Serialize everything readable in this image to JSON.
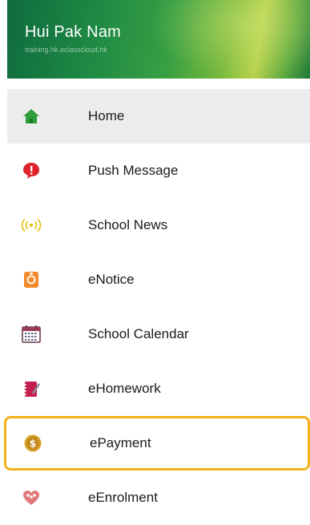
{
  "header": {
    "user_name": "Hui Pak Nam",
    "user_sub": "training.hk.eclasscloud.hk"
  },
  "menu": {
    "items": [
      {
        "label": "Home",
        "icon": "home-icon",
        "color": "#2e9e3c"
      },
      {
        "label": "Push Message",
        "icon": "chat-bubble-icon",
        "color": "#e0222b"
      },
      {
        "label": "School News",
        "icon": "broadcast-icon",
        "color": "#e8c21c"
      },
      {
        "label": "eNotice",
        "icon": "notice-icon",
        "color": "#f08a2a"
      },
      {
        "label": "School Calendar",
        "icon": "calendar-icon",
        "color": "#9c3a5a"
      },
      {
        "label": "eHomework",
        "icon": "notebook-icon",
        "color": "#c4204f"
      },
      {
        "label": "ePayment",
        "icon": "coin-icon",
        "color": "#d9a12a"
      },
      {
        "label": "eEnrolment",
        "icon": "enrolment-icon",
        "color": "#e07a7a"
      }
    ]
  },
  "colors": {
    "highlight_border": "#f2b21a",
    "active_bg": "#ececec"
  }
}
